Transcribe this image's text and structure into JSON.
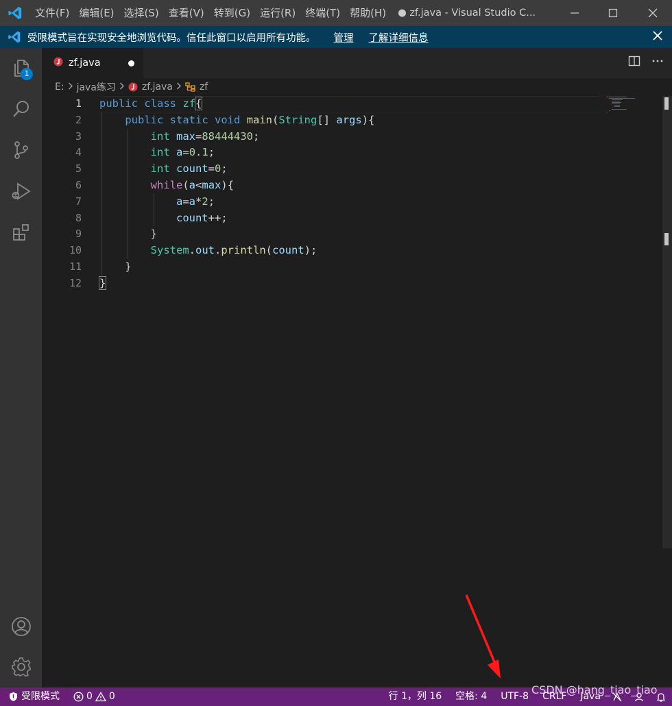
{
  "titlebar": {
    "menus": [
      "文件(F)",
      "编辑(E)",
      "选择(S)",
      "查看(V)",
      "转到(G)",
      "运行(R)",
      "终端(T)",
      "帮助(H)"
    ],
    "window_title": "● zf.java - Visual Studio C..."
  },
  "banner": {
    "message": "受限模式旨在实现安全地浏览代码。信任此窗口以启用所有功能。",
    "manage_link": "管理",
    "learn_more_link": "了解详细信息"
  },
  "activity_bar": {
    "explorer_badge": "1"
  },
  "tab": {
    "label": "zf.java"
  },
  "breadcrumbs": {
    "drive": "E:",
    "folder": "java练习",
    "file": "zf.java",
    "symbol": "zf"
  },
  "editor": {
    "line_numbers": [
      "1",
      "2",
      "3",
      "4",
      "5",
      "6",
      "7",
      "8",
      "9",
      "10",
      "11",
      "12"
    ],
    "code": {
      "l1": {
        "kw1": "public",
        "kw2": "class",
        "name": "zf",
        "brace": "{"
      },
      "l2": {
        "kw1": "public",
        "kw2": "static",
        "kw3": "void",
        "fn": "main",
        "p1": "(",
        "ty": "String",
        "p2": "[] ",
        "arg": "args",
        "p3": "){"
      },
      "l3": {
        "ty": "int",
        "var": "max",
        "eq": "=",
        "num": "88444430",
        "end": ";"
      },
      "l4": {
        "ty": "int",
        "var": "a",
        "eq": "=",
        "num": "0.1",
        "end": ";"
      },
      "l5": {
        "ty": "int",
        "var": "count",
        "eq": "=",
        "num": "0",
        "end": ";"
      },
      "l6": {
        "kw": "while",
        "p1": "(",
        "v1": "a",
        "op": "<",
        "v2": "max",
        "p2": "){"
      },
      "l7": {
        "v1": "a",
        "eq": "=",
        "v2": "a",
        "op": "*",
        "num": "2",
        "end": ";"
      },
      "l8": {
        "var": "count",
        "op": "++;"
      },
      "l9": {
        "brace": "}"
      },
      "l10": {
        "ty": "System",
        "dot1": ".",
        "var": "out",
        "dot2": ".",
        "fn": "println",
        "p1": "(",
        "arg": "count",
        "p2": ");"
      },
      "l11": {
        "brace": "}"
      },
      "l12": {
        "brace": "}"
      }
    }
  },
  "statusbar": {
    "restricted_mode": "受限模式",
    "errors": "0",
    "warnings": "0",
    "position": "行 1，列 16",
    "spaces": "空格: 4",
    "encoding": "UTF-8",
    "eol": "CRLF",
    "language": "Java"
  },
  "watermark": "CSDN @hang_tiao_tiao",
  "colors": {
    "statusbar": "#68217a",
    "banner": "#063b5a",
    "annotation_arrow": "#ff1a1a"
  }
}
